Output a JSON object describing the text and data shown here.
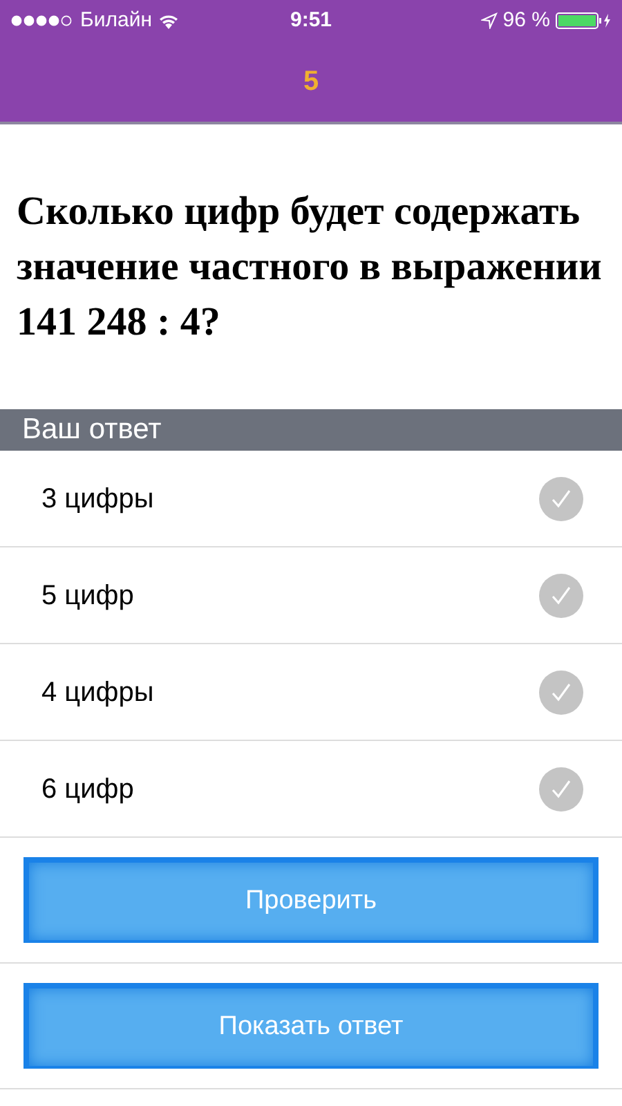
{
  "status_bar": {
    "carrier": "Билайн",
    "time": "9:51",
    "battery": "96 %"
  },
  "nav": {
    "title": "5"
  },
  "question": "Сколько цифр будет содержать значение частного в выражении 141 248 : 4?",
  "section_header": "Ваш ответ",
  "options": [
    {
      "label": "3 цифры",
      "selected": false
    },
    {
      "label": "5 цифр",
      "selected": false
    },
    {
      "label": "4 цифры",
      "selected": false
    },
    {
      "label": "6 цифр",
      "selected": false
    }
  ],
  "buttons": [
    "Проверить",
    "Показать ответ"
  ]
}
